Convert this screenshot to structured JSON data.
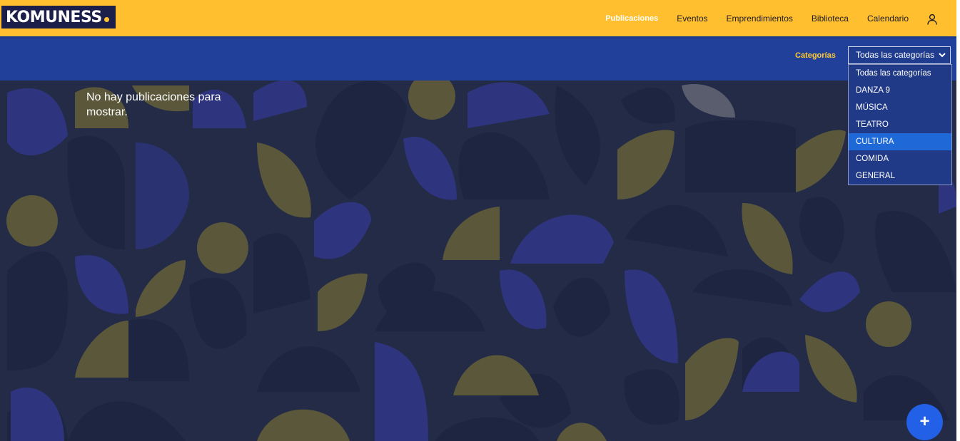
{
  "brand": {
    "logo_text": "KOMUNESS"
  },
  "nav": {
    "items": [
      {
        "label": "Publicaciones",
        "active": true
      },
      {
        "label": "Eventos",
        "active": false
      },
      {
        "label": "Emprendimientos",
        "active": false
      },
      {
        "label": "Biblioteca",
        "active": false
      },
      {
        "label": "Calendario",
        "active": false
      }
    ],
    "user_icon": "user-icon"
  },
  "filter": {
    "label": "Categorías",
    "selected": "Todas las categorías",
    "options": [
      {
        "label": "Todas las categorías",
        "highlighted": false
      },
      {
        "label": "DANZA 9",
        "highlighted": false
      },
      {
        "label": "MÚSICA",
        "highlighted": false
      },
      {
        "label": "TEATRO",
        "highlighted": false
      },
      {
        "label": "CULTURA",
        "highlighted": true
      },
      {
        "label": "COMIDA",
        "highlighted": false
      },
      {
        "label": "GENERAL",
        "highlighted": false
      }
    ]
  },
  "main": {
    "empty_message": "No hay publicaciones para mostrar."
  },
  "fab": {
    "label": "+",
    "icon": "plus-icon"
  },
  "colors": {
    "header": "#ffbf2e",
    "filter_bar": "#20409a",
    "background": "#232b46",
    "highlight": "#1e68d8",
    "accent": "#ffc933"
  }
}
